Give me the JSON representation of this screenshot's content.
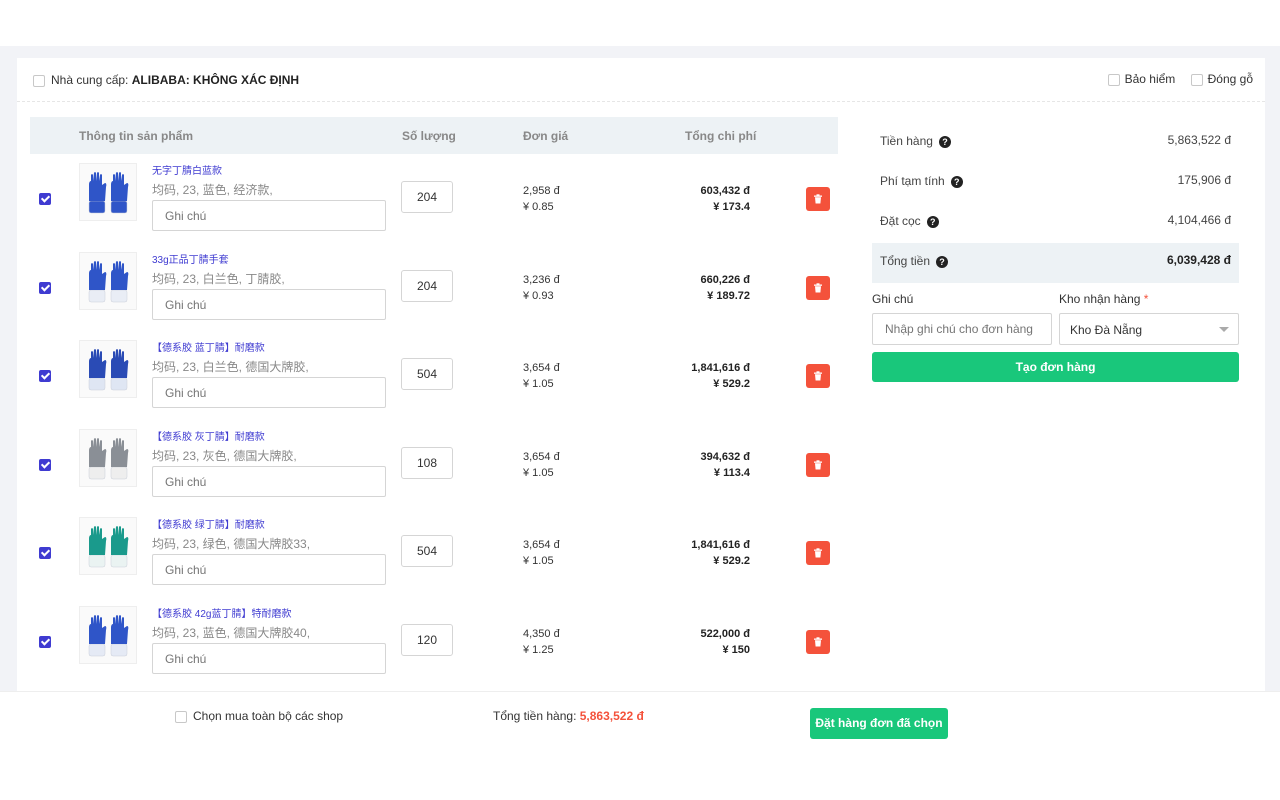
{
  "supplier": {
    "label": "Nhà cung cấp:",
    "name": "ALIBABA: KHÔNG XÁC ĐỊNH",
    "options": [
      {
        "label": "Bảo hiểm",
        "checked": false
      },
      {
        "label": "Đóng gỗ",
        "checked": false
      }
    ]
  },
  "table": {
    "headers": {
      "product": "Thông tin sản phẩm",
      "quantity": "Số lượng",
      "unit_price": "Đơn giá",
      "total": "Tổng chi phí"
    },
    "note_placeholder": "Ghi chú",
    "rows": [
      {
        "name": "无字丁腈白蓝款",
        "attrs": "均码, 23, 蓝色, 经济款,",
        "qty": "204",
        "price_vnd": "2,958 đ",
        "price_cny": "¥ 0.85",
        "total_vnd": "603,432 đ",
        "total_cny": "¥ 173.4",
        "checked": true,
        "glove_color": "#2f55c8",
        "cuff": "#2f55c8"
      },
      {
        "name": "33g正品丁腈手套",
        "attrs": "均码, 23, 白兰色, 丁腈胶,",
        "qty": "204",
        "price_vnd": "3,236 đ",
        "price_cny": "¥ 0.93",
        "total_vnd": "660,226 đ",
        "total_cny": "¥ 189.72",
        "checked": true,
        "glove_color": "#2f55c8",
        "cuff": "#e9edf5"
      },
      {
        "name": "【德系胶 蓝丁腈】耐磨款",
        "attrs": "均码, 23, 白兰色, 德国大牌胶,",
        "qty": "504",
        "price_vnd": "3,654 đ",
        "price_cny": "¥ 1.05",
        "total_vnd": "1,841,616 đ",
        "total_cny": "¥ 529.2",
        "checked": true,
        "glove_color": "#2a4bb5",
        "cuff": "#dfe6f3"
      },
      {
        "name": "【德系胶 灰丁腈】耐磨款",
        "attrs": "均码, 23, 灰色, 德国大牌胶,",
        "qty": "108",
        "price_vnd": "3,654 đ",
        "price_cny": "¥ 1.05",
        "total_vnd": "394,632 đ",
        "total_cny": "¥ 113.4",
        "checked": true,
        "glove_color": "#8a8f96",
        "cuff": "#eeeeee"
      },
      {
        "name": "【德系胶 绿丁腈】耐磨款",
        "attrs": "均码, 23, 绿色, 德国大牌胶33,",
        "qty": "504",
        "price_vnd": "3,654 đ",
        "price_cny": "¥ 1.05",
        "total_vnd": "1,841,616 đ",
        "total_cny": "¥ 529.2",
        "checked": true,
        "glove_color": "#1a9a8c",
        "cuff": "#eaf3f2"
      },
      {
        "name": "【德系胶 42g蓝丁腈】特耐磨款",
        "attrs": "均码, 23, 蓝色, 德国大牌胶40,",
        "qty": "120",
        "price_vnd": "4,350 đ",
        "price_cny": "¥ 1.25",
        "total_vnd": "522,000 đ",
        "total_cny": "¥ 150",
        "checked": true,
        "glove_color": "#2f55c8",
        "cuff": "#e5eaf5"
      }
    ]
  },
  "summary": {
    "goods_label": "Tiền hàng",
    "goods_value": "5,863,522 đ",
    "fee_label": "Phí tạm tính",
    "fee_value": "175,906 đ",
    "deposit_label": "Đặt cọc",
    "deposit_value": "4,104,466 đ",
    "total_label": "Tổng tiền",
    "total_value": "6,039,428 đ"
  },
  "order_form": {
    "note_label": "Ghi chú",
    "note_placeholder": "Nhập ghi chú cho đơn hàng",
    "warehouse_label": "Kho nhận hàng",
    "required_mark": "*",
    "warehouse_value": "Kho Đà Nẵng",
    "create_button": "Tạo đơn hàng"
  },
  "footer": {
    "select_all_label": "Chọn mua toàn bộ các shop",
    "sum_label": "Tổng tiền hàng:",
    "sum_value": "5,863,522 đ",
    "order_button": "Đặt hàng đơn đã chọn"
  },
  "colors": {
    "accent": "#3f3bd1",
    "green": "#19c77b",
    "danger": "#f4523b"
  }
}
